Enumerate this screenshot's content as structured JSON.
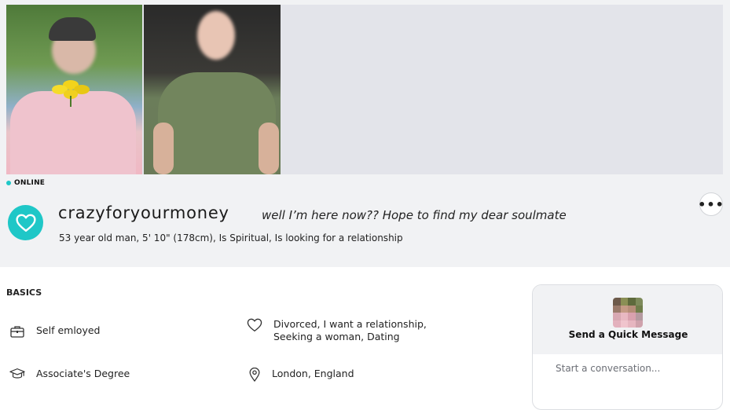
{
  "profile": {
    "status": "ONLINE",
    "username": "crazyforyourmoney",
    "tagline": "well I’m here now?? Hope to find my dear soulmate",
    "summary": "53 year old man, 5' 10\" (178cm), Is Spiritual, Is looking for a relationship",
    "more_icon": "•••"
  },
  "basics": {
    "title": "BASICS",
    "items": [
      {
        "icon": "briefcase-icon",
        "text": "Self emloyed"
      },
      {
        "icon": "heart-outline-icon",
        "text_line1": "Divorced, I want a relationship,",
        "text_line2": "Seeking a woman, Dating"
      },
      {
        "icon": "graduation-cap-icon",
        "text": "Associate's Degree"
      },
      {
        "icon": "location-pin-icon",
        "text": "London, England"
      }
    ]
  },
  "quick_message": {
    "title": "Send a Quick Message",
    "placeholder": "Start a conversation..."
  },
  "colors": {
    "accent": "#1fc7c7",
    "panel_bg": "#f1f2f4",
    "photo_placeholder": "#e3e4ea"
  }
}
